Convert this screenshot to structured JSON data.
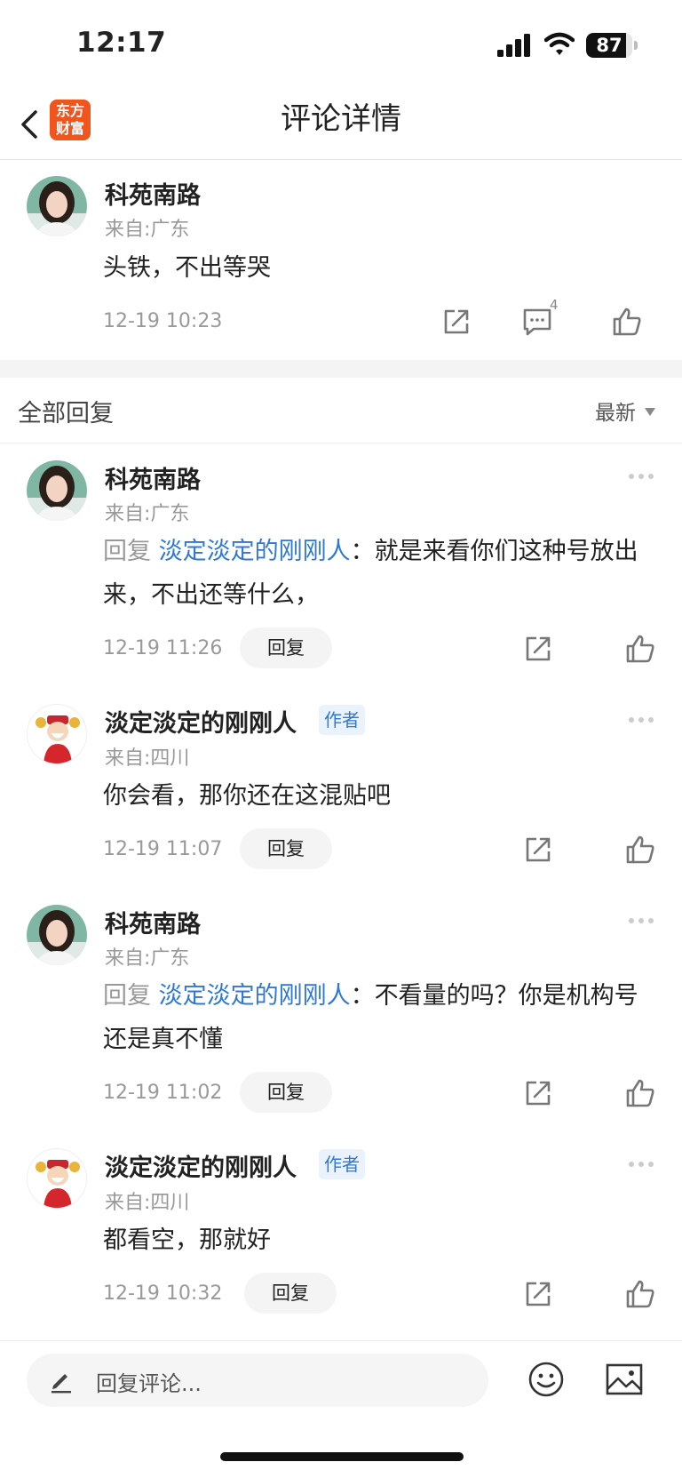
{
  "status_bar": {
    "time": "12:17",
    "battery": "87",
    "battery_level": 0.87
  },
  "nav": {
    "logo_line1": "东方",
    "logo_line2": "财富",
    "title": "评论详情"
  },
  "main_comment": {
    "username": "科苑南路",
    "location": "来自:广东",
    "text": "头铁，不出等哭",
    "time": "12-19 10:23",
    "reply_count": "4"
  },
  "replies_header": {
    "title": "全部回复",
    "sort": "最新"
  },
  "replies": [
    {
      "username": "科苑南路",
      "location": "来自:广东",
      "reply_prefix": "回复 ",
      "mention": "淡定淡定的刚刚人",
      "text": "就是来看你们这种号放出来，不出还等什么，",
      "time": "12-19 11:26",
      "reply_label": "回复"
    },
    {
      "username": "淡定淡定的刚刚人",
      "author_badge": "作者",
      "location": "来自:四川",
      "text": "你会看，那你还在这混贴吧",
      "time": "12-19 11:07",
      "reply_label": "回复"
    },
    {
      "username": "科苑南路",
      "location": "来自:广东",
      "reply_prefix": "回复 ",
      "mention": "淡定淡定的刚刚人",
      "text": "不看量的吗？你是机构号还是真不懂",
      "time": "12-19 11:02",
      "reply_label": "回复"
    },
    {
      "username": "淡定淡定的刚刚人",
      "author_badge": "作者",
      "location": "来自:四川",
      "text": "都看空，那就好",
      "time": "12-19 10:32",
      "reply_label": "回复"
    }
  ],
  "bottom_bar": {
    "placeholder": "回复评论..."
  },
  "icons": {
    "share": "share-icon",
    "comment": "comment-icon",
    "like": "thumbs-up-icon",
    "more": "more-dots-icon",
    "emoji": "emoji-icon",
    "image": "image-icon",
    "edit": "pencil-icon"
  },
  "colors": {
    "mention": "#2f79d3",
    "brand": "#f2541e",
    "muted": "#999999"
  }
}
